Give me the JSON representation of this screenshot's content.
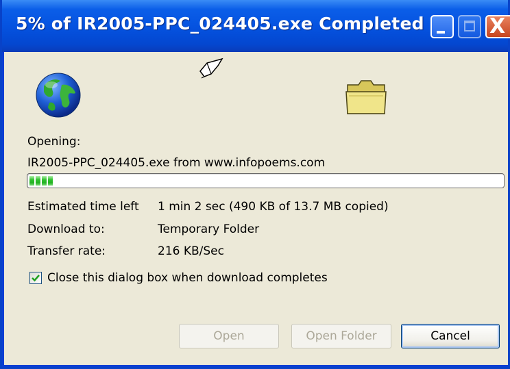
{
  "window": {
    "title": "5% of IR2005-PPC_024405.exe Completed",
    "controls": {
      "minimize_icon": "minimize-icon",
      "maximize_icon": "maximize-icon",
      "close_icon": "close-icon",
      "close_glyph": "X"
    }
  },
  "icons": {
    "source": "globe-icon",
    "transfer": "flying-paper-icon",
    "destination": "folder-icon"
  },
  "status": {
    "opening_label": "Opening:",
    "file_line": "IR2005-PPC_024405.exe from www.infopoems.com"
  },
  "progress": {
    "percent": 5
  },
  "details": {
    "time_left_label": "Estimated time left",
    "time_left_value": "1 min 2 sec (490 KB of 13.7 MB copied)",
    "download_to_label": "Download to:",
    "download_to_value": "Temporary Folder",
    "transfer_rate_label": "Transfer rate:",
    "transfer_rate_value": "216 KB/Sec"
  },
  "options": {
    "close_on_complete_label": "Close this dialog box when download completes",
    "close_on_complete_checked": true
  },
  "buttons": {
    "open_label": "Open",
    "open_folder_label": "Open Folder",
    "cancel_label": "Cancel"
  },
  "colors": {
    "titlebar": "#0553e0",
    "client_bg": "#ece9d8",
    "progress_green": "#2fc22f"
  }
}
